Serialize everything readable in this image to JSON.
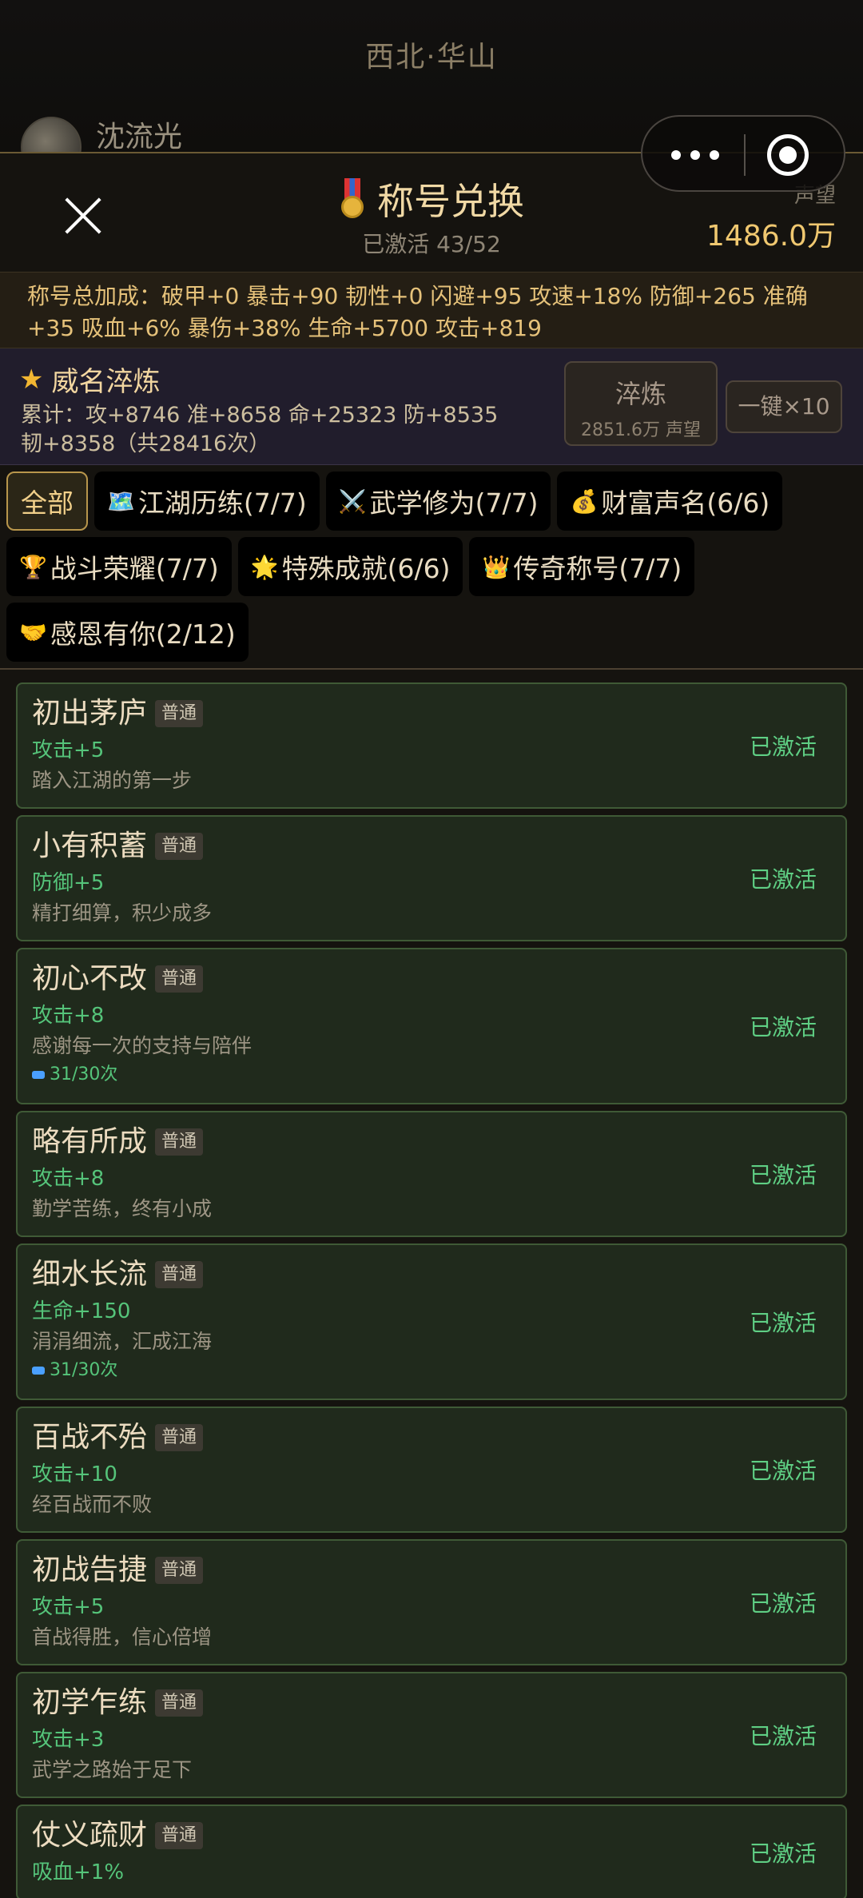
{
  "location_title": "西北·华山",
  "player_name": "沈流光",
  "modal": {
    "title": "称号兑换",
    "subtitle": "已激活 43/52",
    "reputation_label": "声望",
    "reputation_value": "1486.0万"
  },
  "bonus_summary": "称号总加成：破甲+0  暴击+90  韧性+0  闪避+95  攻速+18%  防御+265  准确+35  吸血+6%  暴伤+38%  生命+5700  攻击+819",
  "refine": {
    "title": "威名淬炼",
    "stats": "累计：攻+8746  准+8658  命+25323  防+8535  韧+8358（共28416次）",
    "button_label": "淬炼",
    "button_cost": "2851.6万 声望",
    "one_click_label": "一键×10"
  },
  "tabs": [
    {
      "icon": "",
      "label": "全部",
      "active": true
    },
    {
      "icon": "🗺️",
      "label": "江湖历练(7/7)"
    },
    {
      "icon": "⚔️",
      "label": "武学修为(7/7)"
    },
    {
      "icon": "💰",
      "label": "财富声名(6/6)"
    },
    {
      "icon": "🏆",
      "label": "战斗荣耀(7/7)"
    },
    {
      "icon": "🌟",
      "label": "特殊成就(6/6)"
    },
    {
      "icon": "👑",
      "label": "传奇称号(7/7)"
    },
    {
      "icon": "🤝",
      "label": "感恩有你(2/12)"
    }
  ],
  "titles": [
    {
      "name": "初出茅庐",
      "rarity": "普通",
      "bonus": "攻击+5",
      "desc": "踏入江湖的第一步",
      "count": "",
      "status": "已激活"
    },
    {
      "name": "小有积蓄",
      "rarity": "普通",
      "bonus": "防御+5",
      "desc": "精打细算，积少成多",
      "count": "",
      "status": "已激活"
    },
    {
      "name": "初心不改",
      "rarity": "普通",
      "bonus": "攻击+8",
      "desc": "感谢每一次的支持与陪伴",
      "count": "31/30次",
      "status": "已激活"
    },
    {
      "name": "略有所成",
      "rarity": "普通",
      "bonus": "攻击+8",
      "desc": "勤学苦练，终有小成",
      "count": "",
      "status": "已激活"
    },
    {
      "name": "细水长流",
      "rarity": "普通",
      "bonus": "生命+150",
      "desc": "涓涓细流，汇成江海",
      "count": "31/30次",
      "status": "已激活"
    },
    {
      "name": "百战不殆",
      "rarity": "普通",
      "bonus": "攻击+10",
      "desc": "经百战而不败",
      "count": "",
      "status": "已激活"
    },
    {
      "name": "初战告捷",
      "rarity": "普通",
      "bonus": "攻击+5",
      "desc": "首战得胜，信心倍增",
      "count": "",
      "status": "已激活"
    },
    {
      "name": "初学乍练",
      "rarity": "普通",
      "bonus": "攻击+3",
      "desc": "武学之路始于足下",
      "count": "",
      "status": "已激活"
    },
    {
      "name": "仗义疏财",
      "rarity": "普通",
      "bonus": "吸血+1%",
      "desc": "",
      "count": "",
      "status": "已激活"
    }
  ]
}
